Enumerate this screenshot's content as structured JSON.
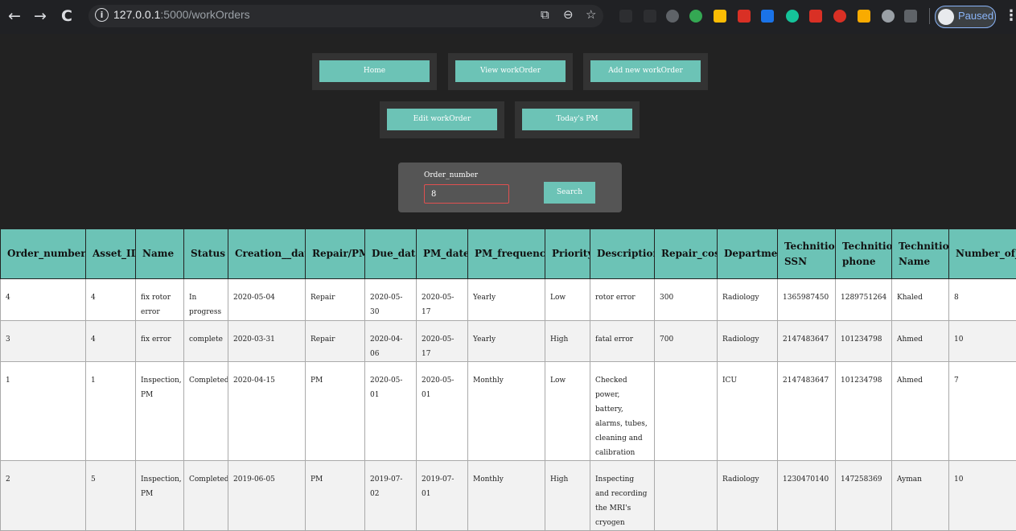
{
  "browser": {
    "url_host": "127.0.0.1",
    "url_rest": ":5000/workOrders",
    "profile_status": "Paused",
    "extensions": [
      {
        "name": "translate-icon",
        "color": "#5f6368"
      },
      {
        "name": "zoom-icon",
        "color": "#5f6368"
      },
      {
        "name": "star-icon",
        "color": "#5f6368"
      },
      {
        "name": "ext-dark-icon",
        "color": "#3c4043"
      },
      {
        "name": "ext-r-icon",
        "color": "#3c4043"
      },
      {
        "name": "ext-chat-icon",
        "color": "#5f6368"
      },
      {
        "name": "ext-green-bubble-icon",
        "color": "#34a853"
      },
      {
        "name": "ext-yellow-icon",
        "color": "#fbbc04"
      },
      {
        "name": "ext-pdf-icon",
        "color": "#d93025"
      },
      {
        "name": "ext-new-icon",
        "color": "#1a73e8"
      },
      {
        "name": "ext-grammarly-icon",
        "color": "#15c39a"
      },
      {
        "name": "ext-off-icon",
        "color": "#d93025"
      },
      {
        "name": "ext-gmail-icon",
        "color": "#d93025"
      },
      {
        "name": "ext-check-icon",
        "color": "#f9ab00"
      },
      {
        "name": "ext-circle-icon",
        "color": "#9aa0a6"
      },
      {
        "name": "ext-square-icon",
        "color": "#5f6368"
      }
    ]
  },
  "nav": {
    "home": "Home",
    "view": "View workOrder",
    "add": "Add new workOrder",
    "edit": "Edit workOrder",
    "today": "Today's PM"
  },
  "search": {
    "label": "Order_number",
    "value": "8",
    "button": "Search"
  },
  "table": {
    "headers": [
      "Order_number",
      "Asset_ID",
      "Name",
      "Status",
      "Creation__date",
      "Repair/PM",
      "Due_date",
      "PM_date",
      "PM_frequency",
      "Priority",
      "Description",
      "Repair_cost",
      "Department",
      "Technition SSN",
      "Technition phone",
      "Technition Name",
      "Number_of_hours"
    ],
    "rows": [
      [
        "4",
        "4",
        "fix rotor error",
        "In progress",
        "2020-05-04",
        "Repair",
        "2020-05-30",
        "2020-05-17",
        "Yearly",
        "Low",
        "rotor error",
        "300",
        "Radiology",
        "1365987450",
        "1289751264",
        "Khaled",
        "8"
      ],
      [
        "3",
        "4",
        "fix error",
        "complete",
        "2020-03-31",
        "Repair",
        "2020-04-06",
        "2020-05-17",
        "Yearly",
        "High",
        "fatal error",
        "700",
        "Radiology",
        "2147483647",
        "101234798",
        "Ahmed",
        "10"
      ],
      [
        "1",
        "1",
        "Inspection, PM",
        "Completed",
        "2020-04-15",
        "PM",
        "2020-05-01",
        "2020-05-01",
        "Monthly",
        "Low",
        "Checked power, battery, alarms, tubes, cleaning and calibration",
        "",
        "ICU",
        "2147483647",
        "101234798",
        "Ahmed",
        "7"
      ],
      [
        "2",
        "5",
        "Inspection, PM",
        "Completed",
        "2019-06-05",
        "PM",
        "2019-07-02",
        "2019-07-01",
        "Monthly",
        "High",
        "Inspecting and recording the MRI's cryogen",
        "",
        "Radiology",
        "1230470140",
        "147258369",
        "Ayman",
        "10"
      ]
    ]
  },
  "colors": {
    "accent": "#6cc3b6",
    "header_bg": "#222222",
    "input_border": "#e05050"
  }
}
